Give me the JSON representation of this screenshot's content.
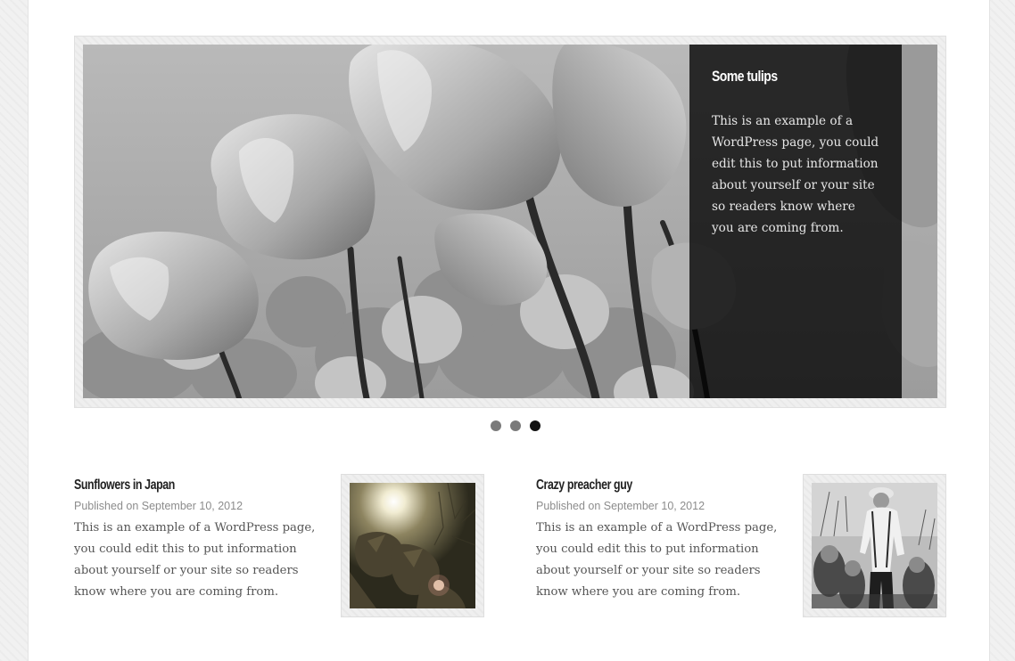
{
  "slider": {
    "caption_title": "Some tulips",
    "caption_text": "This is an example of a WordPress page, you could edit this to put information about yourself or your site so readers know where you are coming from.",
    "image_name": "tulips-photo",
    "dots_count": 3,
    "active_dot": 3
  },
  "posts": [
    {
      "title": "Sunflowers in Japan",
      "meta": "Published on September 10, 2012",
      "excerpt": "This is an example of a WordPress page, you could edit this to put information about yourself or your site so readers know where you are coming from.",
      "thumb_name": "sunflower-photo"
    },
    {
      "title": "Crazy preacher guy",
      "meta": "Published on September 10, 2012",
      "excerpt": "This is an example of a WordPress page, you could edit this to put information about yourself or your site so readers know where you are coming from.",
      "thumb_name": "preacher-photo"
    }
  ],
  "colors": {
    "caption_bg": "#000000",
    "dot_inactive": "#7a7a7a",
    "dot_active": "#111111",
    "meta_text": "#8c8c8c"
  }
}
